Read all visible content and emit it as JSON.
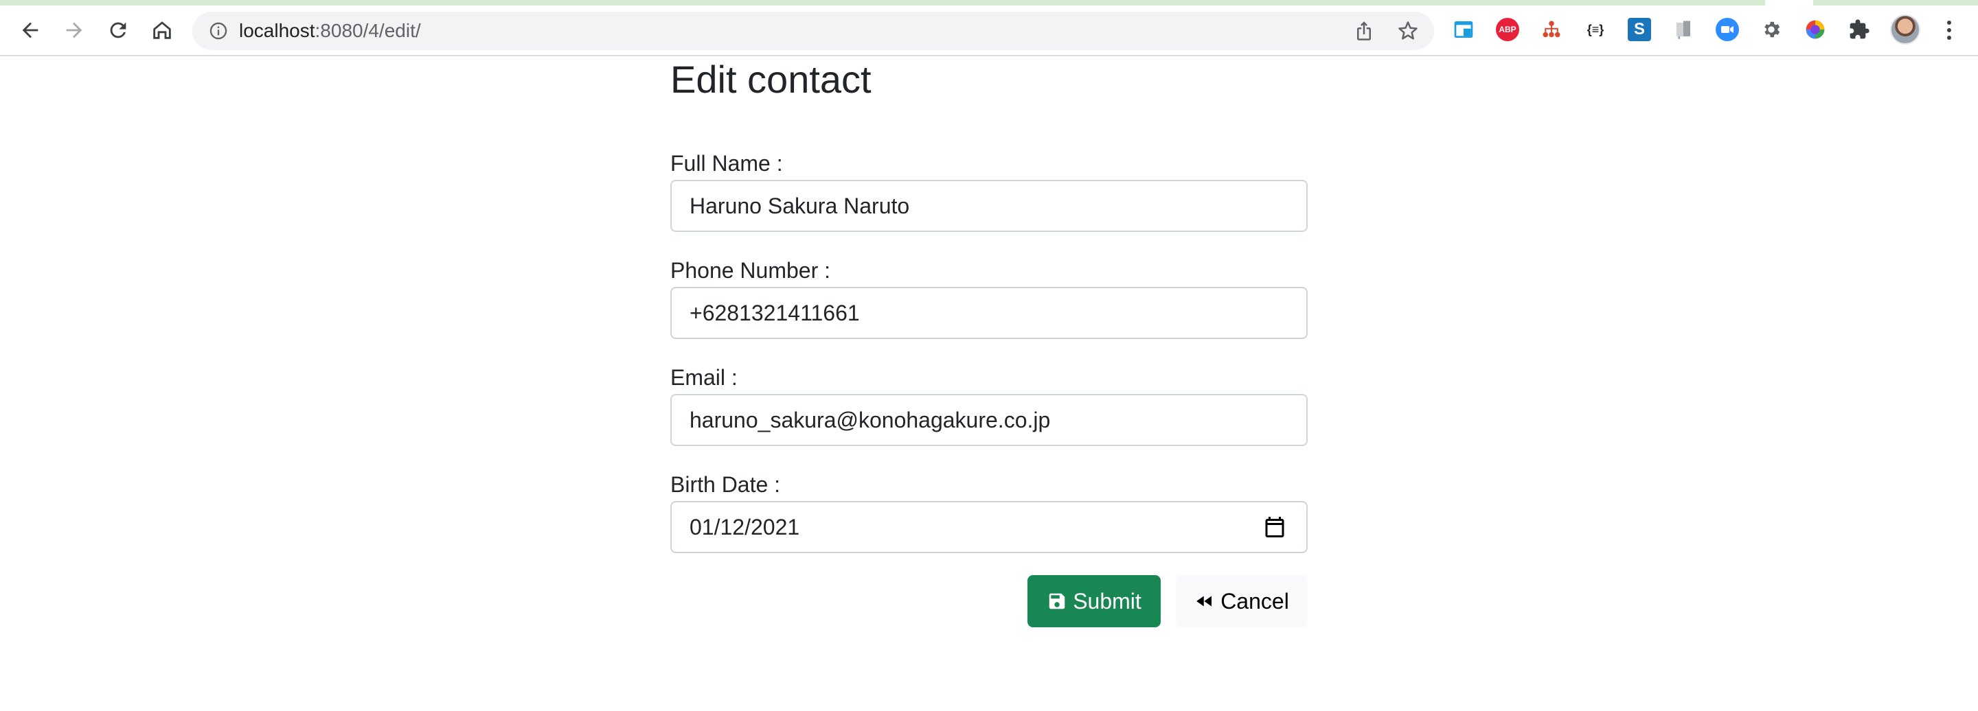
{
  "browser": {
    "url_host": "localhost",
    "url_path": ":8080/4/edit/",
    "toolbar_icons": [
      "back-arrow-icon",
      "forward-arrow-icon",
      "reload-icon",
      "home-icon",
      "site-info-icon",
      "share-icon",
      "bookmark-star-icon"
    ],
    "extensions": [
      {
        "name": "window-resizer-extension-icon",
        "label": "",
        "color": "#1a9de0"
      },
      {
        "name": "adblock-plus-extension-icon",
        "label": "ABP",
        "color": "#e8213b"
      },
      {
        "name": "network-tree-extension-icon",
        "label": "",
        "color": "#d9482b"
      },
      {
        "name": "json-formatter-extension-icon",
        "label": "{≡}",
        "color": "#202124"
      },
      {
        "name": "s-extension-icon",
        "label": "S",
        "color": "#1b75bb"
      },
      {
        "name": "flags-extension-icon",
        "label": "",
        "color": "#9aa0a6"
      },
      {
        "name": "zoom-extension-icon",
        "label": "",
        "color": "#2d8cff"
      },
      {
        "name": "settings-gear-extension-icon",
        "label": "",
        "color": "#5f6368"
      },
      {
        "name": "color-picker-extension-icon",
        "label": "",
        "color": "#7b3fe4"
      },
      {
        "name": "extensions-puzzle-icon",
        "label": "",
        "color": "#3c4043"
      }
    ]
  },
  "page": {
    "title": "Edit contact"
  },
  "form": {
    "full_name": {
      "label": "Full Name :",
      "value": "Haruno Sakura Naruto"
    },
    "phone": {
      "label": "Phone Number :",
      "value": "+6281321411661"
    },
    "email": {
      "label": "Email :",
      "value": "haruno_sakura@konohagakure.co.jp"
    },
    "birth_date": {
      "label": "Birth Date :",
      "value": "01/12/2021"
    },
    "submit_label": "Submit",
    "cancel_label": "Cancel"
  },
  "colors": {
    "submit_bg": "#198754",
    "cancel_bg": "#f8f9fa",
    "tab_strip": "#d6ecd1"
  }
}
